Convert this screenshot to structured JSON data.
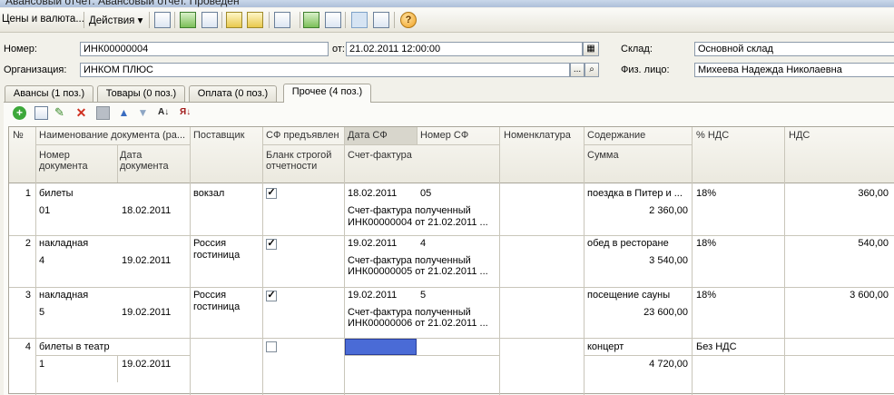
{
  "window": {
    "title": "Авансовый отчет: Авансовый отчет. Проведен"
  },
  "toolbar": {
    "prices_label": "Цены и валюта...",
    "actions_label": "Действия ▾",
    "help_glyph": "?"
  },
  "form": {
    "number_label": "Номер:",
    "number_value": "ИНК00000004",
    "date_label": "от:",
    "date_value": "21.02.2011 12:00:00",
    "org_label": "Организация:",
    "org_value": "ИНКОМ ПЛЮС",
    "warehouse_label": "Склад:",
    "warehouse_value": "Основной склад",
    "person_label": "Физ. лицо:",
    "person_value": "Михеева  Надежда Николаевна",
    "ellipsis": "..."
  },
  "tabs": [
    {
      "label": "Авансы (1 поз.)"
    },
    {
      "label": "Товары (0 поз.)"
    },
    {
      "label": "Оплата (0 поз.)"
    },
    {
      "label": "Прочее (4 поз.)"
    }
  ],
  "grid": {
    "headers": {
      "num": "№",
      "docname": "Наименование документа (ра...",
      "docnum": "Номер документа",
      "docdate": "Дата документа",
      "supplier": "Поставщик",
      "sf_presented": "СФ предъявлен",
      "strict_form": "Бланк строгой отчетности",
      "sf_date": "Дата СФ",
      "sf_number": "Номер СФ",
      "invoice": "Счет-фактура",
      "nomenclature": "Номенклатура",
      "content": "Содержание",
      "sum": "Сумма",
      "vat_rate": "% НДС",
      "vat": "НДС"
    },
    "rows": [
      {
        "n": "1",
        "name": "билеты",
        "docnum": "01",
        "docdate": "18.02.2011",
        "supplier": "вокзал",
        "supplier2": "",
        "sf": true,
        "sf_date": "18.02.2011",
        "sf_num": "05",
        "inv1": "Счет-фактура полученный",
        "inv2": "ИНК00000004 от 21.02.2011 ...",
        "content": "поездка в Питер и ...",
        "sum": "2 360,00",
        "rate": "18%",
        "vat": "360,00"
      },
      {
        "n": "2",
        "name": "накладная",
        "docnum": "4",
        "docdate": "19.02.2011",
        "supplier": "Россия",
        "supplier2": "гостиница",
        "sf": true,
        "sf_date": "19.02.2011",
        "sf_num": "4",
        "inv1": "Счет-фактура полученный",
        "inv2": "ИНК00000005 от 21.02.2011 ...",
        "content": "обед в ресторане",
        "sum": "3 540,00",
        "rate": "18%",
        "vat": "540,00"
      },
      {
        "n": "3",
        "name": "накладная",
        "docnum": "5",
        "docdate": "19.02.2011",
        "supplier": "Россия",
        "supplier2": "гостиница",
        "sf": true,
        "sf_date": "19.02.2011",
        "sf_num": "5",
        "inv1": "Счет-фактура полученный",
        "inv2": "ИНК00000006 от 21.02.2011 ...",
        "content": "посещение сауны",
        "sum": "23 600,00",
        "rate": "18%",
        "vat": "3 600,00"
      },
      {
        "n": "4",
        "name": "билеты в театр",
        "docnum": "1",
        "docdate": "19.02.2011",
        "supplier": "",
        "supplier2": "",
        "sf": false,
        "sf_date": "",
        "sf_num": "",
        "inv1": "",
        "inv2": "",
        "content": "концерт",
        "sum": "4 720,00",
        "rate": "Без НДС",
        "vat": ""
      }
    ]
  },
  "colors": {
    "selection": "#4a6bd6",
    "window_bg": "#f2f1ea"
  }
}
